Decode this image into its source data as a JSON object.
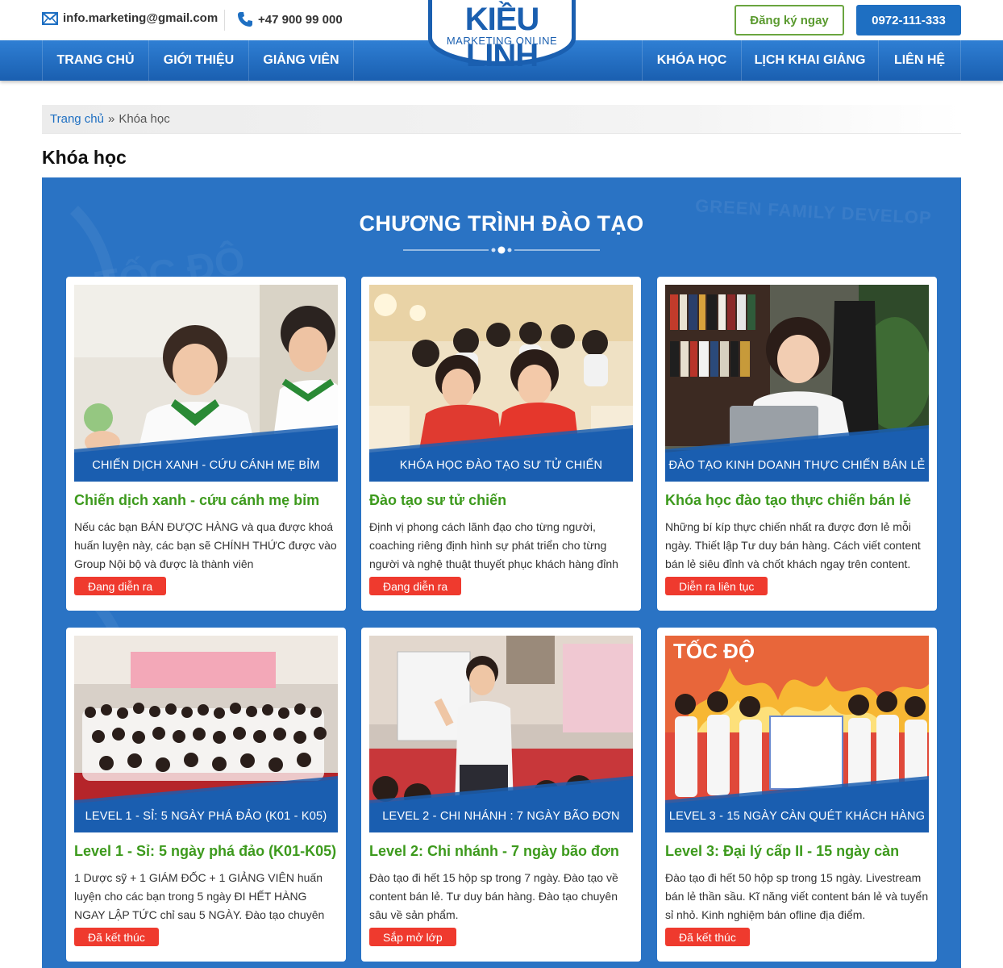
{
  "header": {
    "email": "info.marketing@gmail.com",
    "phone": "+47 900 99 000",
    "register_label": "Đăng ký ngay",
    "hotline": "0972-111-333",
    "logo_title": "KIỀU LINH",
    "logo_subtitle": "MARKETING ONLINE",
    "icons": [
      "mail-icon",
      "phone-icon"
    ]
  },
  "nav": {
    "items": [
      {
        "label": "TRANG CHỦ"
      },
      {
        "label": "GIỚI THIỆU"
      },
      {
        "label": "GIẢNG VIÊN"
      },
      {
        "label": "KHÓA HỌC"
      },
      {
        "label": "LỊCH KHAI GIẢNG"
      },
      {
        "label": "LIÊN HỆ"
      }
    ]
  },
  "breadcrumb": {
    "home": "Trang chủ",
    "separator": "»",
    "current": "Khóa học"
  },
  "page_title": "Khóa học",
  "section": {
    "title": "CHƯƠNG TRÌNH ĐÀO TẠO",
    "background_text": "GREEN FAMILY DEVELOP"
  },
  "courses": [
    {
      "banner": "CHIẾN DỊCH XANH - CỨU CÁNH MẸ BỈM",
      "title": "Chiến dịch xanh - cứu cánh mẹ bỉm",
      "description": "Nếu các bạn BÁN ĐƯỢC HÀNG và qua được khoá huấn luyện này, các bạn sẽ CHÍNH THỨC được vào Group Nội bộ và được là thành viên",
      "status": "Đang diễn ra"
    },
    {
      "banner": "KHÓA HỌC ĐÀO TẠO SƯ TỬ CHIẾN",
      "title": "Đào tạo sư tử chiến",
      "description": "Định vị phong cách lãnh đạo cho từng người, coaching riêng định hình sự phát triển cho từng người và nghệ thuật thuyết phục khách hàng đỉnh",
      "status": "Đang diễn ra"
    },
    {
      "banner": "ĐÀO TẠO KINH DOANH THỰC CHIẾN BÁN LẺ",
      "title": "Khóa học đào tạo thực chiến bán lẻ",
      "description": "Những bí kíp thực chiến nhất ra được đơn lẻ mỗi ngày. Thiết lập Tư duy bán hàng. Cách viết content bán lẻ siêu đỉnh và chốt khách ngay trên content.",
      "status": "Diễn ra liên tục"
    },
    {
      "banner": "LEVEL 1 - SỈ: 5 NGÀY PHÁ ĐẢO (K01 - K05)",
      "title": "Level 1 - Sỉ: 5 ngày phá đảo (K01-K05)",
      "description": "1 Dược sỹ + 1 GIÁM ĐỐC + 1 GIẢNG VIÊN huấn luyện cho các bạn trong 5 ngày ĐI HẾT HÀNG NGAY LẬP TỨC chỉ sau 5 NGÀY. Đào tạo chuyên",
      "status": "Đã kết thúc"
    },
    {
      "banner": "LEVEL 2 - CHI NHÁNH : 7 NGÀY BÃO ĐƠN",
      "title": "Level 2: Chi nhánh - 7 ngày bão đơn",
      "description": "Đào tạo đi hết 15 hộp sp trong 7 ngày. Đào tạo về content bán lẻ. Tư duy bán hàng. Đào tạo chuyên sâu về sản phẩm.",
      "status": "Sắp mở lớp"
    },
    {
      "banner": "LEVEL 3 - 15 NGÀY CÀN QUÉT KHÁCH HÀNG",
      "title": "Level 3: Đại lý cấp II - 15 ngày càn",
      "description": "Đào tạo đi hết 50 hộp sp trong 15 ngày. Livestream bán lẻ thần sầu. Kĩ năng viết content bán lẻ và tuyển sỉ nhỏ. Kinh nghiệm bán ofline địa điểm.",
      "status": "Đã kết thúc"
    }
  ],
  "colors": {
    "brand_blue": "#1e6fc2",
    "section_blue": "#2a73c4",
    "title_green": "#3d9a1d",
    "badge_red": "#ef3a2e",
    "register_green": "#5a9a2f"
  }
}
